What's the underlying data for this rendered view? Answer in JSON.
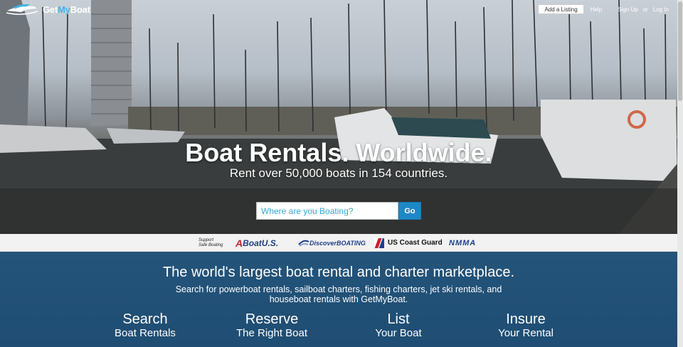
{
  "brand": {
    "name_part1": "Get",
    "name_part2": "My",
    "name_part3": "Boat"
  },
  "nav": {
    "add_listing": "Add a Listing",
    "help": "Help",
    "sign_up": "Sign Up",
    "or": "or",
    "log_in": "Log In"
  },
  "hero": {
    "title": "Boat Rentals. Worldwide.",
    "subtitle": "Rent over 50,000 boats in 154 countries.",
    "search_placeholder": "Where are you Boating?",
    "go_label": "Go"
  },
  "partners": {
    "safe_line1": "Support",
    "safe_line2": "Safe Boating",
    "boatus_a": "A",
    "boatus": "BoatU.S.",
    "discover": "DiscoverBOATING",
    "uscg": "US Coast Guard",
    "nmma": "NMMA"
  },
  "marketplace": {
    "title": "The world's largest boat rental and charter marketplace.",
    "description": "Search for powerboat rentals, sailboat charters, fishing charters, jet ski rentals, and houseboat rentals with GetMyBoat.",
    "features": [
      {
        "heading": "Search",
        "sub": "Boat Rentals"
      },
      {
        "heading": "Reserve",
        "sub": "The Right Boat"
      },
      {
        "heading": "List",
        "sub": "Your Boat"
      },
      {
        "heading": "Insure",
        "sub": "Your Rental"
      }
    ]
  },
  "colors": {
    "accent": "#3fb6e6",
    "go_button": "#1e88c7",
    "section_bg": "#1f4d73"
  }
}
